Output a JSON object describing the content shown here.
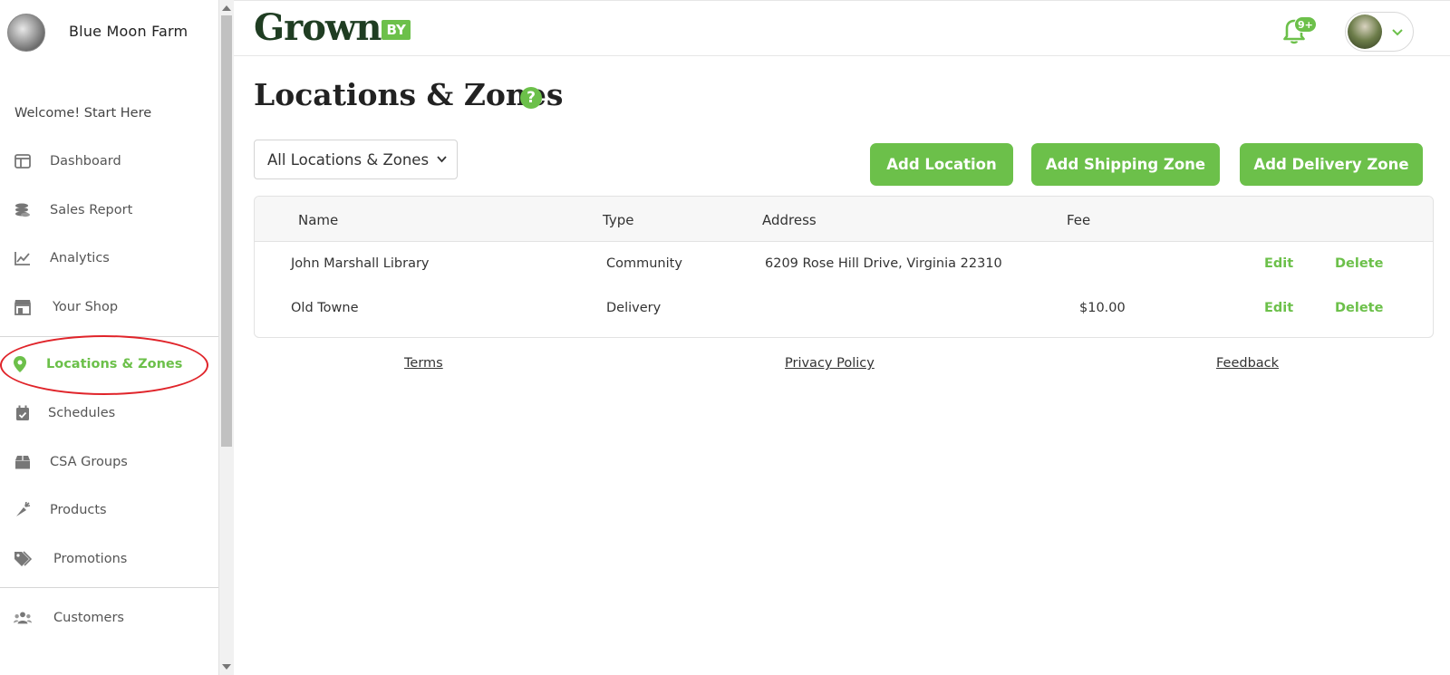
{
  "sidebar": {
    "farm_name": "Blue Moon Farm",
    "welcome": "Welcome! Start Here",
    "items": [
      {
        "label": "Dashboard",
        "icon": "dashboard-icon"
      },
      {
        "label": "Sales Report",
        "icon": "coins-icon"
      },
      {
        "label": "Analytics",
        "icon": "chart-line-icon"
      },
      {
        "label": "Your Shop",
        "icon": "store-icon"
      },
      {
        "label": "Locations & Zones",
        "icon": "map-pin-icon",
        "active": true
      },
      {
        "label": "Schedules",
        "icon": "calendar-check-icon"
      },
      {
        "label": "CSA Groups",
        "icon": "box-icon"
      },
      {
        "label": "Products",
        "icon": "carrot-icon"
      },
      {
        "label": "Promotions",
        "icon": "tags-icon"
      },
      {
        "label": "Customers",
        "icon": "users-icon"
      }
    ]
  },
  "header": {
    "logo_text": "Grown",
    "logo_badge": "BY",
    "notification_count": "9+"
  },
  "main": {
    "title": "Locations & Zones",
    "help": "?",
    "filter": {
      "selected": "All Locations & Zones"
    },
    "buttons": {
      "add_location": "Add Location",
      "add_shipping_zone": "Add Shipping Zone",
      "add_delivery_zone": "Add Delivery Zone"
    },
    "table": {
      "columns": [
        "Name",
        "Type",
        "Address",
        "Fee"
      ],
      "rows": [
        {
          "name": "John Marshall Library",
          "type": "Community",
          "address": "6209 Rose Hill Drive, Virginia 22310",
          "fee": "",
          "edit": "Edit",
          "delete": "Delete"
        },
        {
          "name": "Old Towne",
          "type": "Delivery",
          "address": "",
          "fee": "$10.00",
          "edit": "Edit",
          "delete": "Delete"
        }
      ]
    },
    "footer": {
      "terms": "Terms",
      "privacy": "Privacy Policy",
      "feedback": "Feedback"
    }
  },
  "colors": {
    "accent": "#6cc04a",
    "logo_dark": "#1f3d22",
    "highlight_ring": "#e0242a"
  }
}
